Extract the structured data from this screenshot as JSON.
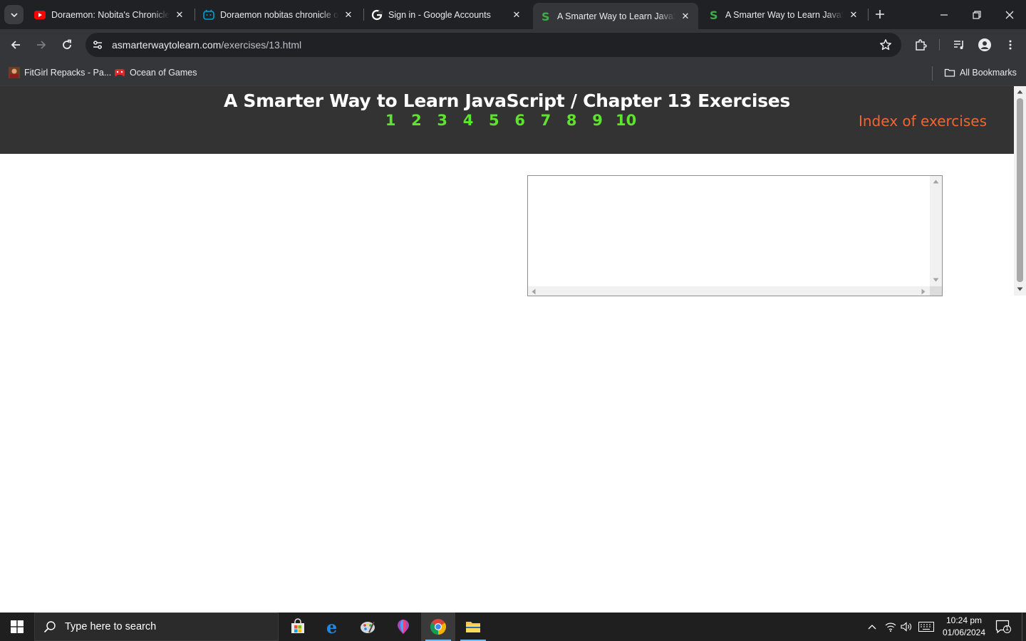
{
  "browser": {
    "tabs": [
      {
        "title": "Doraemon: Nobita's Chronicle of ...",
        "favicon": "youtube-icon",
        "active": false
      },
      {
        "title": "Doraemon nobitas chronicle of ...",
        "favicon": "bilibili-icon",
        "active": false
      },
      {
        "title": "Sign in - Google Accounts",
        "favicon": "google-icon",
        "active": false
      },
      {
        "title": "A Smarter Way to Learn JavaScript",
        "favicon": "smarter-way-s-icon",
        "active": true
      },
      {
        "title": "A Smarter Way to Learn JavaScript",
        "favicon": "smarter-way-s-icon",
        "active": false
      }
    ],
    "url_host": "asmarterwaytolearn.com",
    "url_path": "/exercises/13.html",
    "bookmarks": [
      {
        "label": "FitGirl Repacks - Pa...",
        "icon": "fitgirl-icon"
      },
      {
        "label": "Ocean of Games",
        "icon": "ocean-of-games-icon"
      }
    ],
    "all_bookmarks_label": "All Bookmarks",
    "colors": {
      "tab_bar": "#202124",
      "toolbar": "#35363a"
    }
  },
  "page": {
    "title": "A Smarter Way to Learn JavaScript / Chapter 13 Exercises",
    "exercise_links": [
      "1",
      "2",
      "3",
      "4",
      "5",
      "6",
      "7",
      "8",
      "9",
      "10"
    ],
    "index_link": "Index of exercises",
    "colors": {
      "header_bg": "#333333",
      "exercise_link": "#5ee32e",
      "index_link": "#f26531"
    }
  },
  "taskbar": {
    "search_placeholder": "Type here to search",
    "time": "10:24 pm",
    "date": "01/06/2024",
    "notification_count": "1",
    "apps": [
      "microsoft-store-icon",
      "edge-icon",
      "paint-icon",
      "maps-icon",
      "chrome-icon",
      "file-explorer-icon"
    ]
  }
}
